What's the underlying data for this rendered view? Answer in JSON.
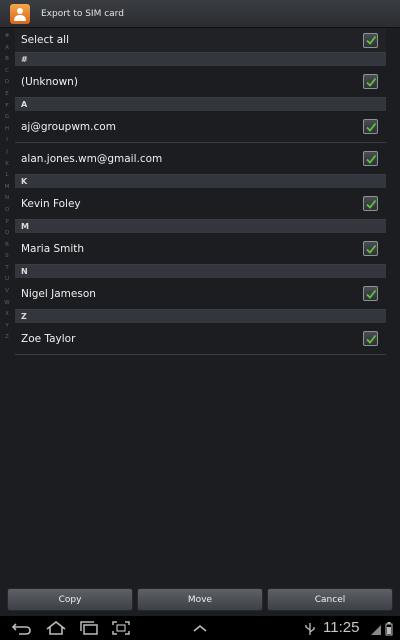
{
  "header": {
    "title": "Export to SIM card",
    "icon": "contacts-icon"
  },
  "index_letters": [
    "#",
    "A",
    "B",
    "C",
    "D",
    "E",
    "F",
    "G",
    "H",
    "I",
    "J",
    "K",
    "L",
    "M",
    "N",
    "O",
    "P",
    "Q",
    "R",
    "S",
    "T",
    "U",
    "V",
    "W",
    "X",
    "Y",
    "Z"
  ],
  "select_all": {
    "label": "Select all",
    "checked": true
  },
  "sections": [
    {
      "header": "#",
      "items": [
        {
          "name": "(Unknown)",
          "checked": true
        }
      ]
    },
    {
      "header": "A",
      "items": [
        {
          "name": "aj@groupwm.com",
          "checked": true
        },
        {
          "name": "alan.jones.wm@gmail.com",
          "checked": true
        }
      ]
    },
    {
      "header": "K",
      "items": [
        {
          "name": "Kevin Foley",
          "checked": true
        }
      ]
    },
    {
      "header": "M",
      "items": [
        {
          "name": "Maria Smith",
          "checked": true
        }
      ]
    },
    {
      "header": "N",
      "items": [
        {
          "name": "Nigel Jameson",
          "checked": true
        }
      ]
    },
    {
      "header": "Z",
      "items": [
        {
          "name": "Zoe Taylor",
          "checked": true
        }
      ]
    }
  ],
  "buttons": {
    "copy": "Copy",
    "move": "Move",
    "cancel": "Cancel"
  },
  "status_bar": {
    "time": "11:25"
  },
  "colors": {
    "check": "#5cc43a",
    "background": "#1b1d20",
    "section": "#33363c"
  }
}
